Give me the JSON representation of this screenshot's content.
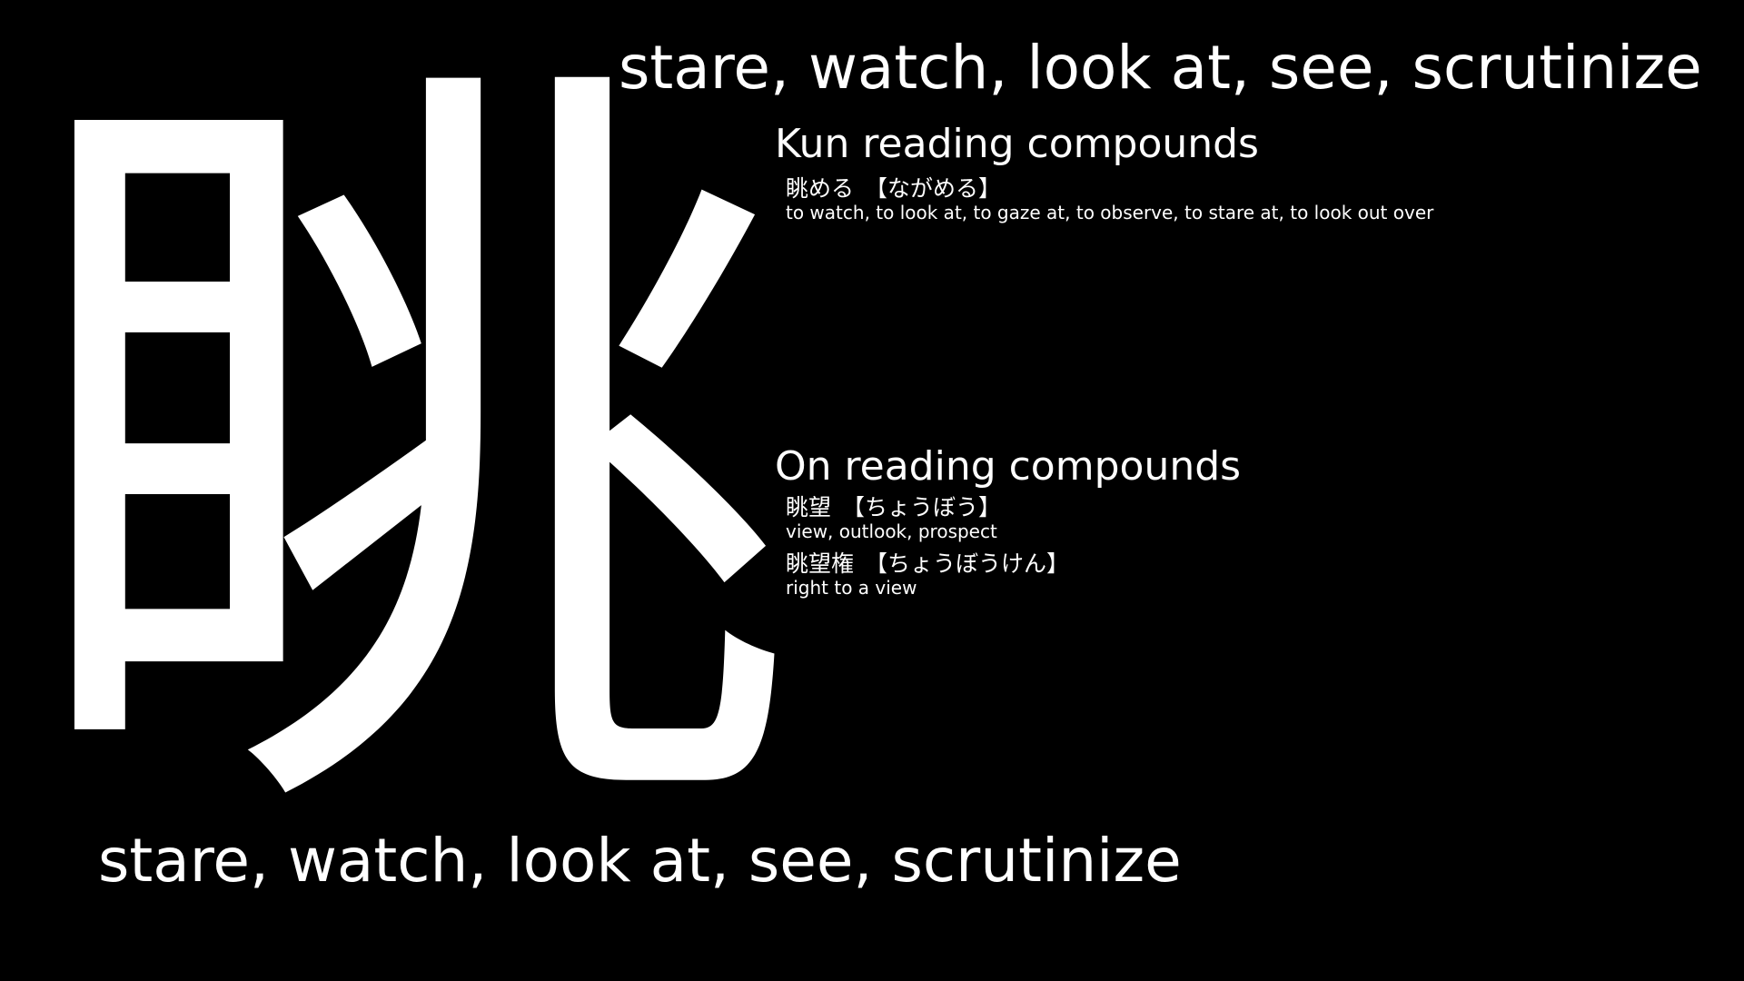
{
  "kanji": "眺",
  "meaning_top": "stare, watch, look at, see, scrutinize",
  "meaning_bottom": "stare, watch, look at, see, scrutinize",
  "kun": {
    "title": "Kun reading compounds",
    "entries": [
      {
        "word": "眺める",
        "reading": "【ながめる】",
        "gloss": "to watch, to look at, to gaze at, to observe, to stare at, to look out over"
      }
    ]
  },
  "on": {
    "title": "On reading compounds",
    "entries": [
      {
        "word": "眺望",
        "reading": "【ちょうぼう】",
        "gloss": "view, outlook, prospect"
      },
      {
        "word": "眺望権",
        "reading": "【ちょうぼうけん】",
        "gloss": "right to a view"
      }
    ]
  },
  "colors": {
    "background": "#000000",
    "text": "#ffffff"
  }
}
